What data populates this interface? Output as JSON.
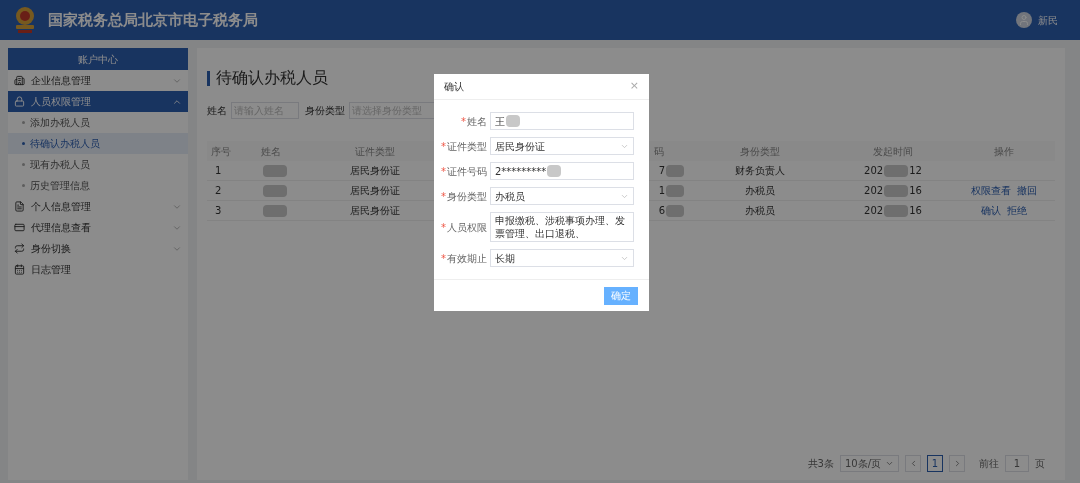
{
  "header": {
    "title": "国家税务总局北京市电子税务局",
    "user": "新民"
  },
  "sidebar": {
    "title": "账户中心",
    "items": [
      {
        "label": "企业信息管理",
        "expanded": false,
        "selected": false
      },
      {
        "label": "人员权限管理",
        "expanded": true,
        "selected": true,
        "children": [
          {
            "label": "添加办税人员",
            "selected": false
          },
          {
            "label": "待确认办税人员",
            "selected": true
          },
          {
            "label": "现有办税人员",
            "selected": false
          },
          {
            "label": "历史管理信息",
            "selected": false
          }
        ]
      },
      {
        "label": "个人信息管理",
        "expanded": false,
        "selected": false
      },
      {
        "label": "代理信息查看",
        "expanded": false,
        "selected": false
      },
      {
        "label": "身份切换",
        "expanded": false,
        "selected": false
      },
      {
        "label": "日志管理"
      }
    ]
  },
  "page": {
    "title": "待确认办税人员",
    "filters": [
      {
        "label": "姓名",
        "placeholder": "请输入姓名"
      },
      {
        "label": "身份类型",
        "placeholder": "请选择身份类型"
      }
    ],
    "table": {
      "columns": [
        "序号",
        "姓名",
        "证件类型",
        "码",
        "身份类型",
        "发起时间",
        "操作"
      ],
      "rows": [
        {
          "index": "1",
          "id_type": "居民身份证",
          "id_number": "7",
          "role": "财务负责人",
          "time": "202",
          "time_end": "12",
          "actions": []
        },
        {
          "index": "2",
          "id_type": "居民身份证",
          "id_number": "1",
          "role": "办税员",
          "time": "202",
          "time_end": "16",
          "actions": [
            "权限查看",
            "撤回"
          ]
        },
        {
          "index": "3",
          "id_type": "居民身份证",
          "id_number": "6",
          "role": "办税员",
          "time": "202",
          "time_end": "16",
          "actions": [
            "确认",
            "拒绝"
          ]
        }
      ]
    },
    "pagination": {
      "total": "共3条",
      "page_size": "10条/页",
      "pages": [
        {
          "label": "1",
          "selected": true
        }
      ],
      "goto_label": "前往",
      "goto_value": "1",
      "goto_suffix": "页"
    }
  },
  "dialog": {
    "title": "确认",
    "close": "×",
    "button": "确定",
    "required_mark": "*",
    "fields": [
      {
        "label": "姓名",
        "kind": "input",
        "value": "王",
        "redacted": true,
        "required": true
      },
      {
        "label": "证件类型",
        "kind": "select",
        "value": "居民身份证",
        "required": true
      },
      {
        "label": "证件号码",
        "kind": "input",
        "value": "2*********",
        "redacted": true,
        "required": true
      },
      {
        "label": "身份类型",
        "kind": "select",
        "value": "办税员",
        "required": true
      },
      {
        "label": "人员权限",
        "kind": "input",
        "value": "申报缴税、涉税事项办理、发票管理、出口退税、",
        "required": true
      },
      {
        "label": "有效期止",
        "kind": "select",
        "value": "长期",
        "required": true
      }
    ]
  }
}
